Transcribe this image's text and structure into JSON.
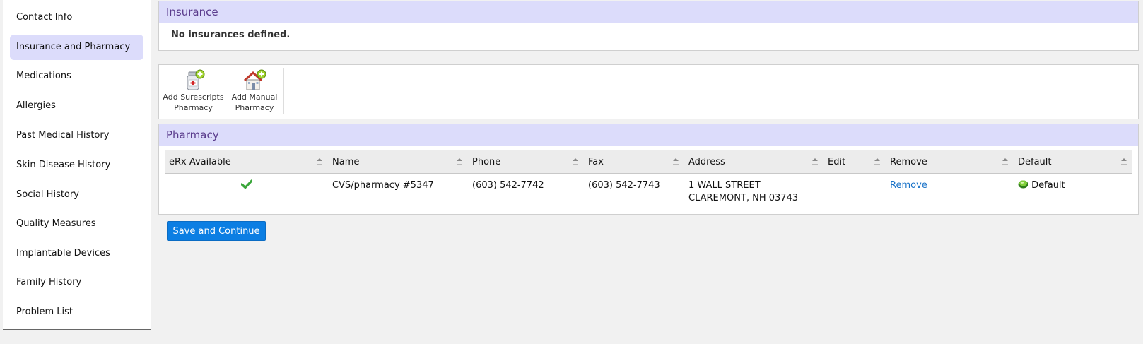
{
  "sidebar": {
    "items": [
      {
        "label": "Contact Info",
        "active": false
      },
      {
        "label": "Insurance and Pharmacy",
        "active": true
      },
      {
        "label": "Medications",
        "active": false
      },
      {
        "label": "Allergies",
        "active": false
      },
      {
        "label": "Past Medical History",
        "active": false
      },
      {
        "label": "Skin Disease History",
        "active": false
      },
      {
        "label": "Social History",
        "active": false
      },
      {
        "label": "Quality Measures",
        "active": false
      },
      {
        "label": "Implantable Devices",
        "active": false
      },
      {
        "label": "Family History",
        "active": false
      },
      {
        "label": "Problem List",
        "active": false
      }
    ]
  },
  "insurance": {
    "title": "Insurance",
    "empty_message": "No insurances defined."
  },
  "toolbar": {
    "surescripts_line1": "Add Surescripts",
    "surescripts_line2": "Pharmacy",
    "manual_line1": "Add Manual",
    "manual_line2": "Pharmacy"
  },
  "pharmacy": {
    "title": "Pharmacy",
    "columns": [
      "eRx Available",
      "Name",
      "Phone",
      "Fax",
      "Address",
      "Edit",
      "Remove",
      "Default"
    ],
    "rows": [
      {
        "erx_available": true,
        "name": "CVS/pharmacy #5347",
        "phone": "(603) 542-7742",
        "fax": "(603) 542-7743",
        "address_line1": "1 WALL STREET",
        "address_line2": "CLAREMONT, NH 03743",
        "edit": "",
        "remove": "Remove",
        "default": "Default"
      }
    ]
  },
  "actions": {
    "save_continue": "Save and Continue"
  },
  "colors": {
    "accent": "#0b7ee3",
    "header_bg": "#dcdcfb",
    "header_text": "#5a3b8c",
    "link": "#1a73c8",
    "check": "#3aa63a"
  }
}
